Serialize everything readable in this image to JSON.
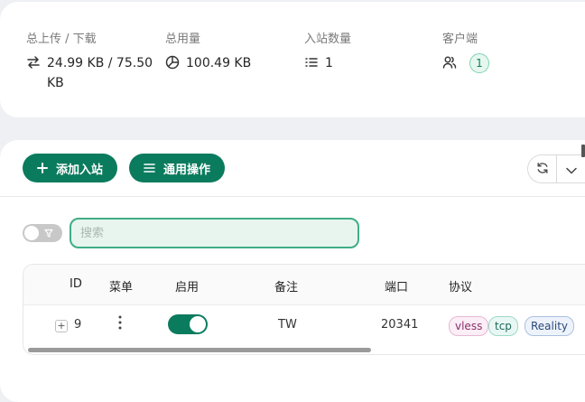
{
  "stats": {
    "traffic": {
      "label": "总上传 / 下载",
      "value": "24.99 KB / 75.50 KB",
      "icon": "swap-icon"
    },
    "usage": {
      "label": "总用量",
      "value": "100.49 KB",
      "icon": "pie-chart-icon"
    },
    "inbounds": {
      "label": "入站数量",
      "value": "1",
      "icon": "list-icon"
    },
    "clients": {
      "label": "客户端",
      "value": "1",
      "icon": "users-icon"
    }
  },
  "toolbar": {
    "add_inbound": "添加入站",
    "general_actions": "通用操作"
  },
  "search": {
    "placeholder": "搜索",
    "value": ""
  },
  "table": {
    "headers": {
      "id": "ID",
      "menu": "菜单",
      "enable": "启用",
      "remark": "备注",
      "port": "端口",
      "protocol": "协议"
    },
    "rows": [
      {
        "id": "9",
        "enabled": true,
        "remark": "TW",
        "port": "20341",
        "tags": [
          "vless",
          "tcp",
          "Reality"
        ]
      }
    ]
  },
  "colors": {
    "primary": "#0b7b5e",
    "accent_border": "#3fae85",
    "background": "#eef0f3"
  }
}
